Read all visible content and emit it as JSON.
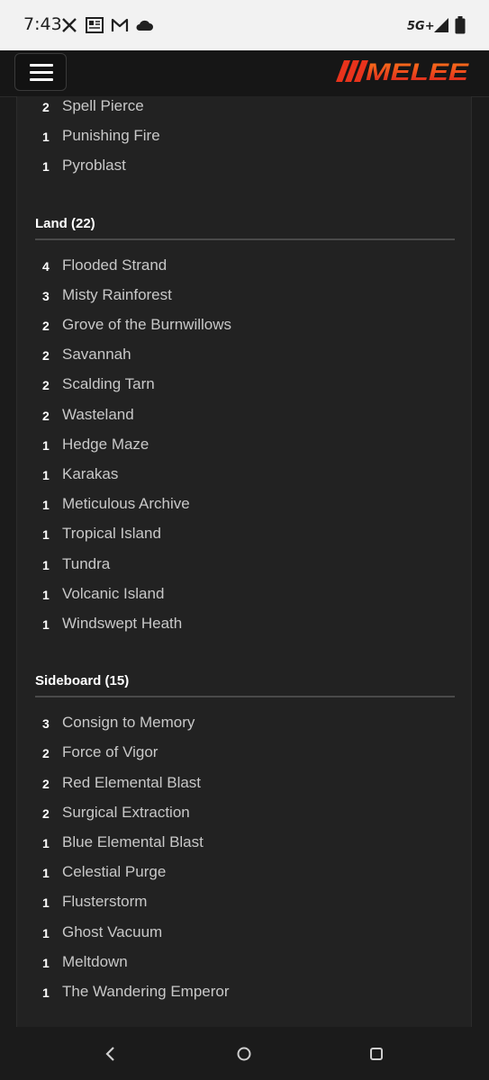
{
  "status_bar": {
    "time": "7:43",
    "network": "5G+"
  },
  "app": {
    "menu_label": "Menu",
    "logo_text": "MELEE",
    "brand_color": "#e8331c"
  },
  "sections": [
    {
      "title": "",
      "cards": [
        {
          "qty": "2",
          "name": "Spell Pierce"
        },
        {
          "qty": "1",
          "name": "Punishing Fire"
        },
        {
          "qty": "1",
          "name": "Pyroblast"
        }
      ]
    },
    {
      "title": "Land (22)",
      "cards": [
        {
          "qty": "4",
          "name": "Flooded Strand"
        },
        {
          "qty": "3",
          "name": "Misty Rainforest"
        },
        {
          "qty": "2",
          "name": "Grove of the Burnwillows"
        },
        {
          "qty": "2",
          "name": "Savannah"
        },
        {
          "qty": "2",
          "name": "Scalding Tarn"
        },
        {
          "qty": "2",
          "name": "Wasteland"
        },
        {
          "qty": "1",
          "name": "Hedge Maze"
        },
        {
          "qty": "1",
          "name": "Karakas"
        },
        {
          "qty": "1",
          "name": "Meticulous Archive"
        },
        {
          "qty": "1",
          "name": "Tropical Island"
        },
        {
          "qty": "1",
          "name": "Tundra"
        },
        {
          "qty": "1",
          "name": "Volcanic Island"
        },
        {
          "qty": "1",
          "name": "Windswept Heath"
        }
      ]
    },
    {
      "title": "Sideboard (15)",
      "cards": [
        {
          "qty": "3",
          "name": "Consign to Memory"
        },
        {
          "qty": "2",
          "name": "Force of Vigor"
        },
        {
          "qty": "2",
          "name": "Red Elemental Blast"
        },
        {
          "qty": "2",
          "name": "Surgical Extraction"
        },
        {
          "qty": "1",
          "name": "Blue Elemental Blast"
        },
        {
          "qty": "1",
          "name": "Celestial Purge"
        },
        {
          "qty": "1",
          "name": "Flusterstorm"
        },
        {
          "qty": "1",
          "name": "Ghost Vacuum"
        },
        {
          "qty": "1",
          "name": "Meltdown"
        },
        {
          "qty": "1",
          "name": "The Wandering Emperor"
        }
      ]
    }
  ],
  "nav_bar": {
    "icons": [
      "back-icon",
      "home-icon",
      "recents-icon"
    ]
  }
}
